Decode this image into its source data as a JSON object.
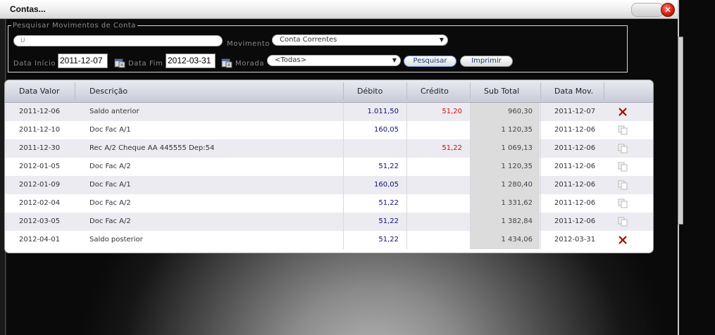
{
  "window": {
    "title": "Contas...",
    "close_label": "✕"
  },
  "search": {
    "legend": "Pesquisar Movimentos de Conta",
    "text_value": "U",
    "movimento_label": "Movimento",
    "movimento_value": "Conta Correntes",
    "data_inicio_label": "Data Início",
    "data_inicio_value": "2011-12-07",
    "data_fim_label": "Data Fim",
    "data_fim_value": "2012-03-31",
    "morada_label": "Morada",
    "morada_value": "<Todas>",
    "pesquisar_label": "Pesquisar",
    "imprimir_label": "Imprimir"
  },
  "table": {
    "columns": [
      "Data Valor",
      "Descrição",
      "Débito",
      "Crédito",
      "Sub Total",
      "Data Mov."
    ],
    "rows": [
      {
        "data_valor": "2011-12-06",
        "descricao": "Saldo anterior",
        "debito": "1.011,50",
        "credito": "51,20",
        "sub_total": "960,30",
        "data_mov": "2011-12-07",
        "action": "delete-icon"
      },
      {
        "data_valor": "2011-12-10",
        "descricao": "Doc Fac A/1",
        "debito": "160,05",
        "credito": "",
        "sub_total": "1 120,35",
        "data_mov": "2011-12-06",
        "action": "copy-icon"
      },
      {
        "data_valor": "2011-12-30",
        "descricao": "Rec A/2 Cheque AA 445555 Dep:54",
        "debito": "",
        "credito": "51,22",
        "sub_total": "1 069,13",
        "data_mov": "2011-12-06",
        "action": "copy-icon"
      },
      {
        "data_valor": "2012-01-05",
        "descricao": "Doc Fac A/2",
        "debito": "51,22",
        "credito": "",
        "sub_total": "1 120,35",
        "data_mov": "2011-12-06",
        "action": "copy-icon"
      },
      {
        "data_valor": "2012-01-09",
        "descricao": "Doc Fac A/1",
        "debito": "160,05",
        "credito": "",
        "sub_total": "1 280,40",
        "data_mov": "2011-12-06",
        "action": "copy-icon"
      },
      {
        "data_valor": "2012-02-04",
        "descricao": "Doc Fac A/2",
        "debito": "51,22",
        "credito": "",
        "sub_total": "1 331,62",
        "data_mov": "2011-12-06",
        "action": "copy-icon"
      },
      {
        "data_valor": "2012-03-05",
        "descricao": "Doc Fac A/2",
        "debito": "51,22",
        "credito": "",
        "sub_total": "1 382,84",
        "data_mov": "2011-12-06",
        "action": "copy-icon"
      },
      {
        "data_valor": "2012-04-01",
        "descricao": "Saldo posterior",
        "debito": "51,22",
        "credito": "",
        "sub_total": "1 434,06",
        "data_mov": "2012-03-31",
        "action": "delete-icon"
      }
    ]
  },
  "colors": {
    "debit": "#101070",
    "credit": "#d01010",
    "delete": "#a00000"
  }
}
